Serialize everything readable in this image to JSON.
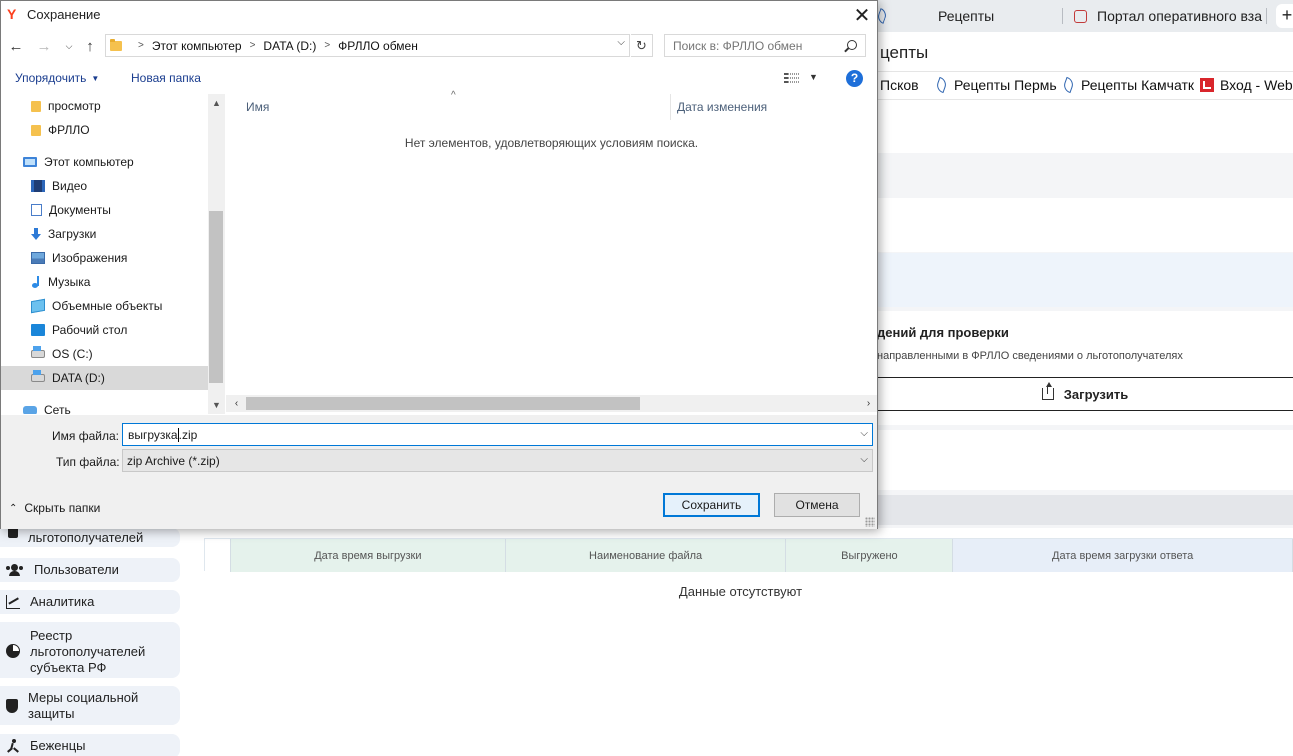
{
  "browser": {
    "tabs": [
      {
        "label": "Рецепты"
      },
      {
        "label": "Портал оперативного вза"
      }
    ],
    "page_title": "цепты",
    "bookmarks": [
      "Псков",
      "Рецепты Пермь",
      "Рецепты Камчатк",
      "Вход - Webin"
    ]
  },
  "page": {
    "section_title": "дений для проверки",
    "section_subtitle": "направленными в ФРЛЛО сведениями о льготополучателях",
    "upload_label": "Загрузить",
    "table": {
      "columns": [
        "Дата время выгрузки",
        "Наименование файла",
        "Выгружено",
        "Дата время загрузки ответа"
      ],
      "empty_text": "Данные отсутствуют"
    },
    "sidebar": [
      {
        "label": "льготополучателей",
        "icon": "doc-icon"
      },
      {
        "label": "Пользователи",
        "icon": "users-icon"
      },
      {
        "label": "Аналитика",
        "icon": "chart-icon"
      },
      {
        "label": "Реестр льготополучателей субъекта РФ",
        "icon": "pie-icon"
      },
      {
        "label": "Меры социальной защиты",
        "icon": "shield-icon"
      },
      {
        "label": "Беженцы",
        "icon": "runner-icon"
      }
    ]
  },
  "dialog": {
    "title": "Сохранение",
    "breadcrumb": [
      "Этот компьютер",
      "DATA (D:)",
      "ФРЛЛО обмен"
    ],
    "search_placeholder": "Поиск в: ФРЛЛО обмен",
    "toolbar": {
      "organize": "Упорядочить",
      "new_folder": "Новая папка",
      "help": "?"
    },
    "nav_tree": [
      {
        "label": "просмотр",
        "icon": "folder-icon"
      },
      {
        "label": "ФРЛЛО",
        "icon": "folder-icon"
      },
      {
        "label": "Этот компьютер",
        "icon": "computer-icon"
      },
      {
        "label": "Видео",
        "icon": "video-icon"
      },
      {
        "label": "Документы",
        "icon": "documents-icon"
      },
      {
        "label": "Загрузки",
        "icon": "downloads-icon"
      },
      {
        "label": "Изображения",
        "icon": "pictures-icon"
      },
      {
        "label": "Музыка",
        "icon": "music-icon"
      },
      {
        "label": "Объемные объекты",
        "icon": "3d-objects-icon"
      },
      {
        "label": "Рабочий стол",
        "icon": "desktop-icon"
      },
      {
        "label": "OS (C:)",
        "icon": "drive-icon"
      },
      {
        "label": "DATA (D:)",
        "icon": "drive-icon",
        "selected": true
      },
      {
        "label": "Сеть",
        "icon": "network-icon"
      }
    ],
    "columns": {
      "name": "Имя",
      "date": "Дата изменения"
    },
    "empty_message": "Нет элементов, удовлетворяющих условиям поиска.",
    "filename_label": "Имя файла:",
    "filename_value_before_caret": "выгрузка",
    "filename_value_after_caret": ".zip",
    "filetype_label": "Тип файла:",
    "filetype_value": "zip Archive (*.zip)",
    "hide_folders": "Скрыть папки",
    "save": "Сохранить",
    "cancel": "Отмена"
  }
}
